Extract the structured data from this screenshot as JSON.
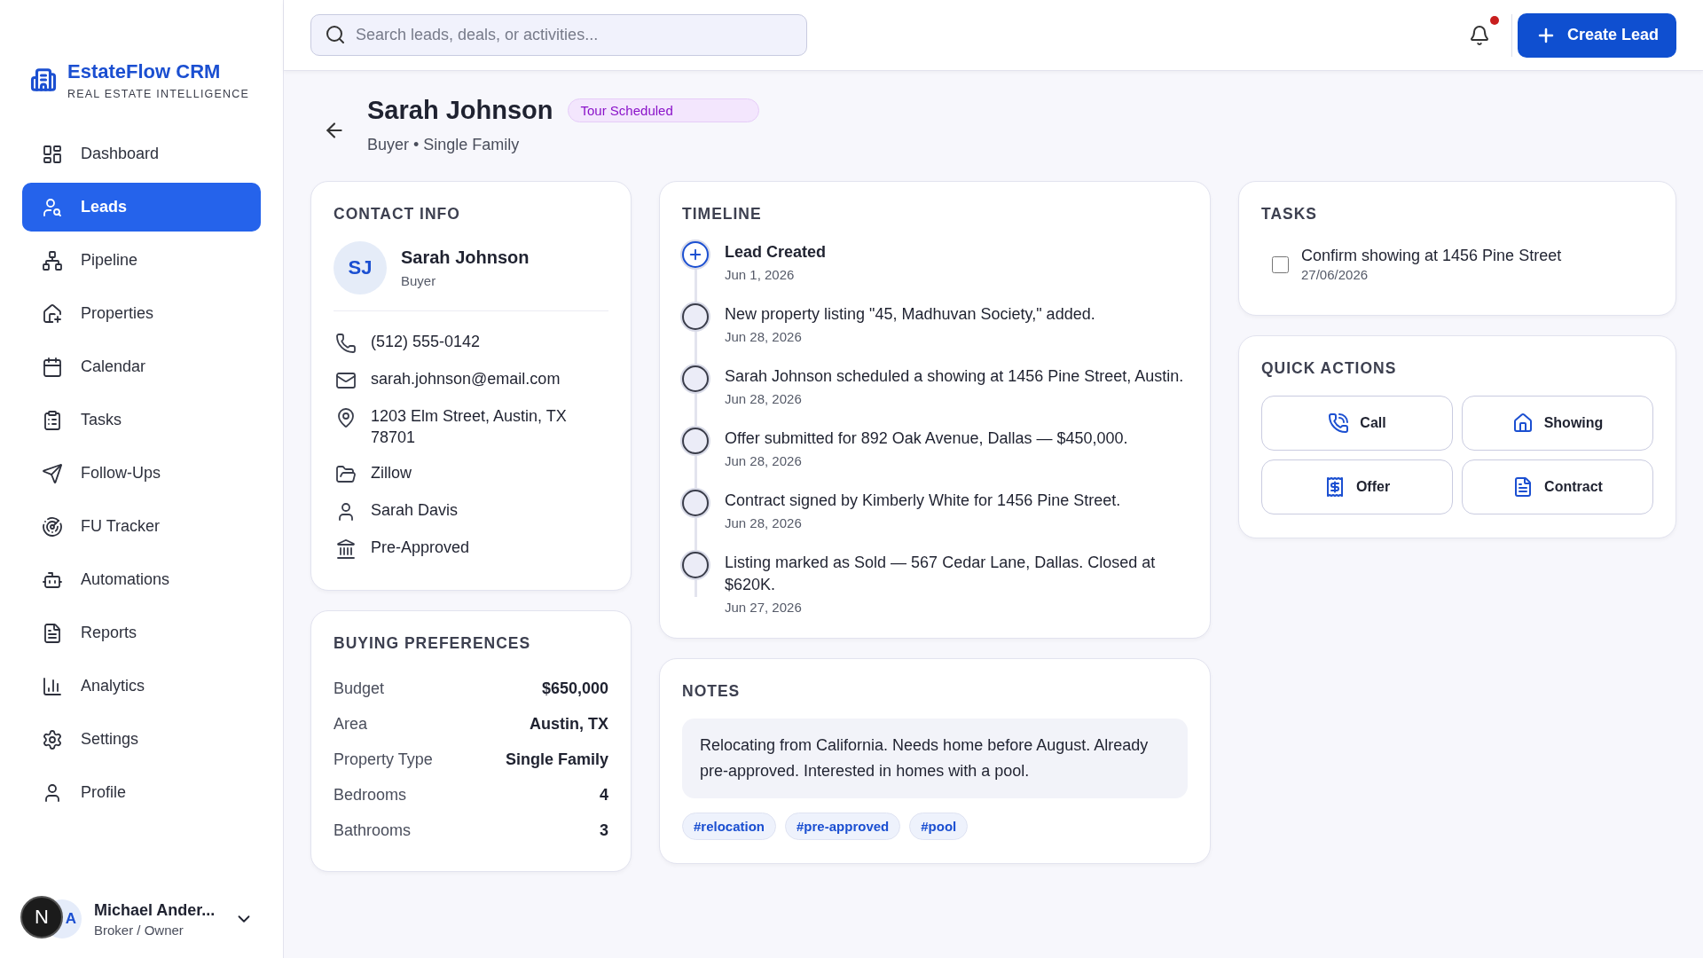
{
  "brand": {
    "name": "EstateFlow CRM",
    "tagline": "REAL ESTATE INTELLIGENCE"
  },
  "sidebar": {
    "items": [
      {
        "label": "Dashboard",
        "selected": false
      },
      {
        "label": "Leads",
        "selected": true
      },
      {
        "label": "Pipeline",
        "selected": false
      },
      {
        "label": "Properties",
        "selected": false
      },
      {
        "label": "Calendar",
        "selected": false
      },
      {
        "label": "Tasks",
        "selected": false
      },
      {
        "label": "Follow-Ups",
        "selected": false
      },
      {
        "label": "FU Tracker",
        "selected": false
      },
      {
        "label": "Automations",
        "selected": false
      },
      {
        "label": "Reports",
        "selected": false
      },
      {
        "label": "Analytics",
        "selected": false
      },
      {
        "label": "Settings",
        "selected": false
      },
      {
        "label": "Profile",
        "selected": false
      }
    ]
  },
  "user": {
    "initials": "A",
    "name": "Michael Ander...",
    "role": "Broker / Owner"
  },
  "dev_badge": {
    "label": "N"
  },
  "header": {
    "search": {
      "placeholder": "Search leads, deals, or activities..."
    },
    "notifications_unread": true,
    "create_button": "Create Lead"
  },
  "lead": {
    "name": "Sarah Johnson",
    "status": "Tour Scheduled",
    "subtitle": "Buyer • Single Family"
  },
  "contact_info": {
    "title": "CONTACT INFO",
    "initials": "SJ",
    "name": "Sarah Johnson",
    "role": "Buyer",
    "details": [
      "(512) 555-0142",
      "sarah.johnson@email.com",
      "1203 Elm Street, Austin, TX 78701",
      "Zillow",
      "Sarah Davis",
      "Pre-Approved"
    ]
  },
  "buying_preferences": {
    "title": "BUYING PREFERENCES",
    "rows": [
      {
        "label": "Budget",
        "value": "$650,000"
      },
      {
        "label": "Area",
        "value": "Austin, TX"
      },
      {
        "label": "Property Type",
        "value": "Single Family"
      },
      {
        "label": "Bedrooms",
        "value": "4"
      },
      {
        "label": "Bathrooms",
        "value": "3"
      }
    ]
  },
  "timeline": {
    "title": "TIMELINE",
    "events": [
      {
        "kind": "created",
        "text": "Lead Created",
        "date": "Jun 1, 2026"
      },
      {
        "kind": "event",
        "text": "New property listing \"45, Madhuvan Society,\" added.",
        "date": "Jun 28, 2026"
      },
      {
        "kind": "event",
        "text": "Sarah Johnson scheduled a showing at 1456 Pine Street, Austin.",
        "date": "Jun 28, 2026"
      },
      {
        "kind": "event",
        "text": "Offer submitted for 892 Oak Avenue, Dallas — $450,000.",
        "date": "Jun 28, 2026"
      },
      {
        "kind": "event",
        "text": "Contract signed by Kimberly White for 1456 Pine Street.",
        "date": "Jun 28, 2026"
      },
      {
        "kind": "event",
        "text": "Listing marked as Sold — 567 Cedar Lane, Dallas. Closed at $620K.",
        "date": "Jun 27, 2026"
      }
    ]
  },
  "notes": {
    "title": "NOTES",
    "text": "Relocating from California. Needs home before August. Already pre-approved. Interested in homes with a pool.",
    "tags": [
      "#relocation",
      "#pre-approved",
      "#pool"
    ]
  },
  "tasks": {
    "title": "TASKS",
    "items": [
      {
        "text": "Confirm showing at 1456 Pine Street",
        "date": "27/06/2026",
        "checked": false
      }
    ]
  },
  "quick_actions": {
    "title": "QUICK ACTIONS",
    "buttons": [
      "Call",
      "Showing",
      "Offer",
      "Contract"
    ]
  }
}
